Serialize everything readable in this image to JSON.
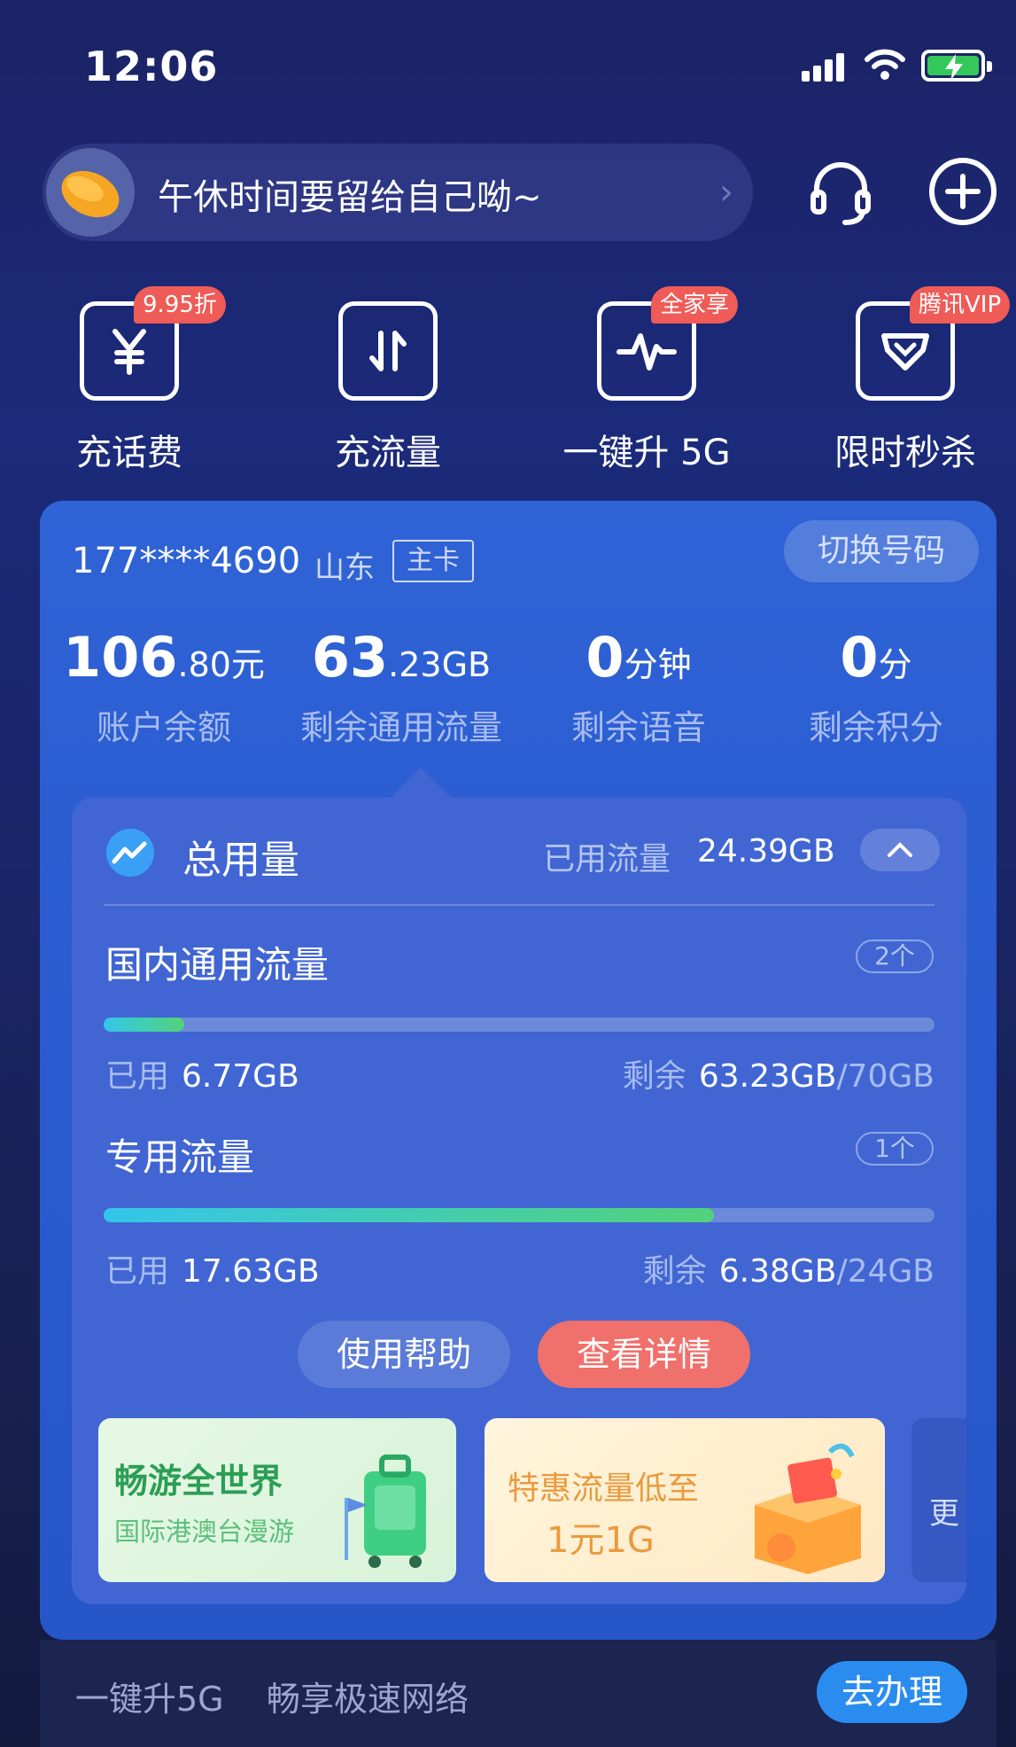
{
  "status_bar": {
    "time": "12:06"
  },
  "header": {
    "greeting": "午休时间要留给自己呦~",
    "icons": [
      "headset-icon",
      "plus-circle-icon"
    ]
  },
  "quick_actions": [
    {
      "label": "充话费",
      "badge": "9.95折",
      "icon": "yuan-icon"
    },
    {
      "label": "充流量",
      "badge": "",
      "icon": "updown-arrows-icon"
    },
    {
      "label": "一键升 5G",
      "badge": "全家享",
      "icon": "pulse-icon"
    },
    {
      "label": "限时秒杀",
      "badge": "腾讯VIP",
      "icon": "diamond-icon"
    }
  ],
  "account": {
    "phone": "177****4690",
    "province": "山东",
    "card_tag": "主卡",
    "switch_label": "切换号码",
    "stats": [
      {
        "value_big": "106",
        "value_small": ".80元",
        "label": "账户余额"
      },
      {
        "value_big": "63",
        "value_small": ".23GB",
        "label": "剩余通用流量"
      },
      {
        "value_big": "0",
        "value_small": "分钟",
        "label": "剩余语音"
      },
      {
        "value_big": "0",
        "value_small": "分",
        "label": "剩余积分"
      }
    ]
  },
  "usage": {
    "title": "总用量",
    "used_label": "已用流量",
    "used_value": "24.39GB",
    "sections": [
      {
        "title": "国内通用流量",
        "count": "2个",
        "used_label": "已用",
        "used": "6.77GB",
        "remain_label": "剩余",
        "remain": "63.23GB",
        "total": "/70GB",
        "progress": 0.097
      },
      {
        "title": "专用流量",
        "count": "1个",
        "used_label": "已用",
        "used": "17.63GB",
        "remain_label": "剩余",
        "remain": "6.38GB",
        "total": "/24GB",
        "progress": 0.735
      }
    ],
    "help_button": "使用帮助",
    "detail_button": "查看详情"
  },
  "promos": [
    {
      "title": "畅游全世界",
      "subtitle": "国际港澳台漫游"
    },
    {
      "title": "特惠流量低至",
      "subtitle": "1元1G"
    },
    {
      "title": "更"
    }
  ],
  "bottom_bar": {
    "text1": "一键升5G",
    "text2": "畅享极速网络",
    "button": "去办理"
  },
  "colors": {
    "accent_red": "#f0706b",
    "accent_blue": "#2b8cf0",
    "card_blue": "#2f63d6",
    "progress_start": "#33c6ea",
    "progress_end": "#52d37a"
  }
}
